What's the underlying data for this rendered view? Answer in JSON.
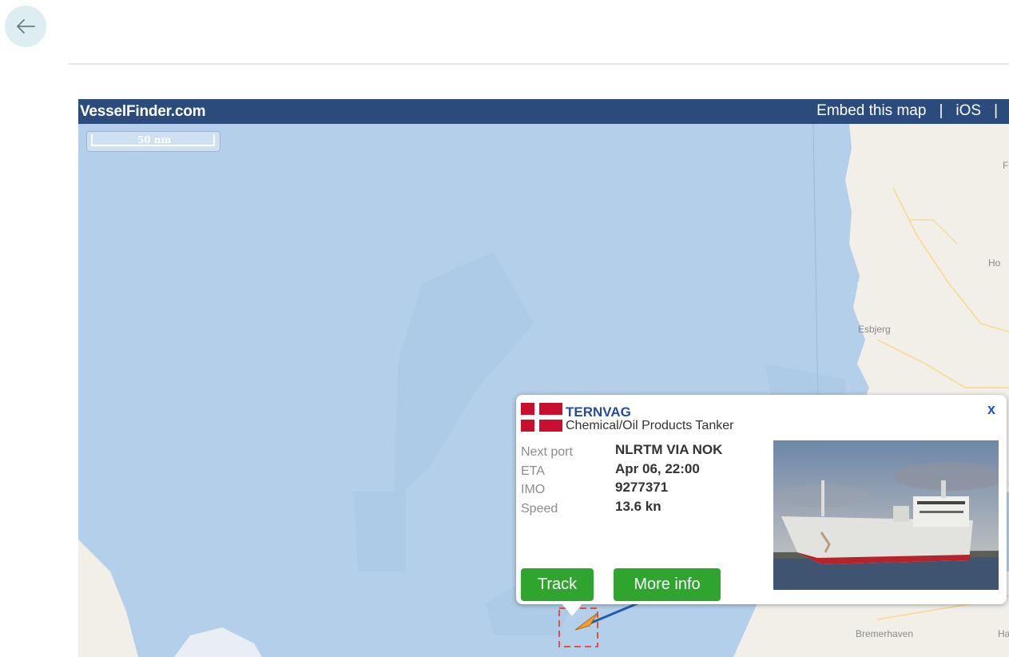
{
  "nav": {
    "back_icon": "arrow-left-icon"
  },
  "map": {
    "brand": "VesselFinder.com",
    "links": [
      "Embed this map",
      "iOS"
    ],
    "scale_label": "50 nm",
    "places": {
      "esbjerg": "Esbjerg",
      "bremerhaven": "Bremerhaven",
      "partial_ho": "Ho",
      "partial_f": "F",
      "partial_ha": "Ha"
    }
  },
  "popup": {
    "flag_icon": "denmark-flag-icon",
    "vessel_name": "TERNVAG",
    "vessel_type": "Chemical/Oil Products Tanker",
    "close_label": "x",
    "fields": [
      {
        "label": "Next port",
        "value": "NLRTM VIA NOK"
      },
      {
        "label": "ETA",
        "value": "Apr 06, 22:00"
      },
      {
        "label": "IMO",
        "value": "9277371"
      },
      {
        "label": "Speed",
        "value": "13.6 kn"
      }
    ],
    "track_label": "Track",
    "more_info_label": "More info",
    "photo_alt": "tanker-photo"
  },
  "colors": {
    "sea": "#b4cfe9",
    "land": "#f2efe9",
    "header": "#2a4b7c",
    "button_green": "#2fa52f",
    "vessel_name": "#264d9b"
  }
}
